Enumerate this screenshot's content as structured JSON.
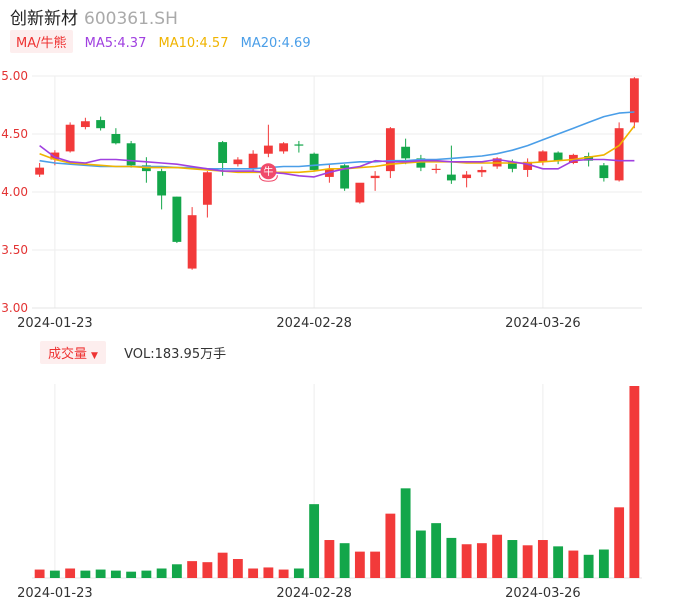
{
  "header": {
    "name": "创新新材",
    "code": "600361.SH"
  },
  "ma_legend": {
    "selector": "MA/牛熊",
    "items": [
      {
        "label": "MA5:4.37",
        "color": "#a040e0"
      },
      {
        "label": "MA10:4.57",
        "color": "#f0b400"
      },
      {
        "label": "MA20:4.69",
        "color": "#4a9ee8"
      }
    ]
  },
  "volume_legend": {
    "selector": "成交量",
    "value": "VOL:183.95万手"
  },
  "bull_marker": "牛",
  "colors": {
    "up": "#f23a3a",
    "down": "#13a64a",
    "price_axis": "#e33333",
    "grid": "#eeeeee"
  },
  "chart_data": [
    {
      "type": "candlestick",
      "y_ticks": [
        "5.00",
        "4.50",
        "4.00",
        "3.50",
        "3.00"
      ],
      "ylim": [
        3.0,
        5.0
      ],
      "x_ticks": [
        {
          "label": "2024-01-23",
          "index": 1
        },
        {
          "label": "2024-02-28",
          "index": 18
        },
        {
          "label": "2024-03-26",
          "index": 33
        }
      ],
      "candles": [
        {
          "o": 4.15,
          "h": 4.25,
          "l": 4.13,
          "c": 4.21
        },
        {
          "o": 4.28,
          "h": 4.36,
          "l": 4.23,
          "c": 4.34
        },
        {
          "o": 4.35,
          "h": 4.6,
          "l": 4.34,
          "c": 4.58
        },
        {
          "o": 4.56,
          "h": 4.64,
          "l": 4.54,
          "c": 4.61
        },
        {
          "o": 4.62,
          "h": 4.65,
          "l": 4.53,
          "c": 4.55
        },
        {
          "o": 4.5,
          "h": 4.55,
          "l": 4.41,
          "c": 4.42
        },
        {
          "o": 4.42,
          "h": 4.44,
          "l": 4.21,
          "c": 4.23
        },
        {
          "o": 4.23,
          "h": 4.3,
          "l": 4.08,
          "c": 4.18
        },
        {
          "o": 4.18,
          "h": 4.2,
          "l": 3.85,
          "c": 3.97
        },
        {
          "o": 3.96,
          "h": 3.96,
          "l": 3.56,
          "c": 3.57
        },
        {
          "o": 3.34,
          "h": 3.87,
          "l": 3.33,
          "c": 3.8
        },
        {
          "o": 3.89,
          "h": 4.18,
          "l": 3.78,
          "c": 4.17
        },
        {
          "o": 4.43,
          "h": 4.44,
          "l": 4.14,
          "c": 4.25
        },
        {
          "o": 4.24,
          "h": 4.3,
          "l": 4.22,
          "c": 4.28
        },
        {
          "o": 4.2,
          "h": 4.36,
          "l": 4.18,
          "c": 4.33
        },
        {
          "o": 4.33,
          "h": 4.58,
          "l": 4.3,
          "c": 4.4
        },
        {
          "o": 4.35,
          "h": 4.43,
          "l": 4.33,
          "c": 4.42
        },
        {
          "o": 4.41,
          "h": 4.44,
          "l": 4.34,
          "c": 4.4
        },
        {
          "o": 4.33,
          "h": 4.34,
          "l": 4.18,
          "c": 4.19
        },
        {
          "o": 4.13,
          "h": 4.24,
          "l": 4.08,
          "c": 4.2
        },
        {
          "o": 4.23,
          "h": 4.24,
          "l": 4.01,
          "c": 4.03
        },
        {
          "o": 3.91,
          "h": 4.07,
          "l": 3.9,
          "c": 4.08
        },
        {
          "o": 4.12,
          "h": 4.18,
          "l": 4.01,
          "c": 4.14
        },
        {
          "o": 4.18,
          "h": 4.56,
          "l": 4.12,
          "c": 4.55
        },
        {
          "o": 4.39,
          "h": 4.46,
          "l": 4.24,
          "c": 4.29
        },
        {
          "o": 4.29,
          "h": 4.32,
          "l": 4.18,
          "c": 4.21
        },
        {
          "o": 4.19,
          "h": 4.24,
          "l": 4.16,
          "c": 4.2
        },
        {
          "o": 4.15,
          "h": 4.4,
          "l": 4.07,
          "c": 4.1
        },
        {
          "o": 4.12,
          "h": 4.18,
          "l": 4.04,
          "c": 4.15
        },
        {
          "o": 4.17,
          "h": 4.22,
          "l": 4.13,
          "c": 4.19
        },
        {
          "o": 4.22,
          "h": 4.3,
          "l": 4.2,
          "c": 4.29
        },
        {
          "o": 4.26,
          "h": 4.28,
          "l": 4.17,
          "c": 4.2
        },
        {
          "o": 4.19,
          "h": 4.29,
          "l": 4.13,
          "c": 4.26
        },
        {
          "o": 4.26,
          "h": 4.36,
          "l": 4.23,
          "c": 4.35
        },
        {
          "o": 4.34,
          "h": 4.35,
          "l": 4.24,
          "c": 4.27
        },
        {
          "o": 4.25,
          "h": 4.33,
          "l": 4.24,
          "c": 4.32
        },
        {
          "o": 4.31,
          "h": 4.34,
          "l": 4.22,
          "c": 4.27
        },
        {
          "o": 4.23,
          "h": 4.25,
          "l": 4.09,
          "c": 4.12
        },
        {
          "o": 4.1,
          "h": 4.6,
          "l": 4.09,
          "c": 4.55
        },
        {
          "o": 4.6,
          "h": 4.99,
          "l": 4.55,
          "c": 4.98
        }
      ],
      "ma5": [
        4.4,
        4.3,
        4.26,
        4.25,
        4.28,
        4.28,
        4.27,
        4.26,
        4.25,
        4.24,
        4.22,
        4.2,
        4.18,
        4.18,
        4.18,
        4.17,
        4.16,
        4.14,
        4.13,
        4.17,
        4.2,
        4.22,
        4.27,
        4.26,
        4.26,
        4.27,
        4.27,
        4.26,
        4.26,
        4.26,
        4.28,
        4.26,
        4.24,
        4.2,
        4.2,
        4.27,
        4.28,
        4.28,
        4.27,
        4.27
      ],
      "ma10": [
        4.33,
        4.28,
        4.25,
        4.24,
        4.23,
        4.22,
        4.22,
        4.21,
        4.21,
        4.21,
        4.2,
        4.19,
        4.18,
        4.17,
        4.17,
        4.17,
        4.17,
        4.17,
        4.18,
        4.2,
        4.2,
        4.21,
        4.22,
        4.24,
        4.25,
        4.26,
        4.26,
        4.26,
        4.25,
        4.25,
        4.25,
        4.25,
        4.25,
        4.26,
        4.27,
        4.28,
        4.3,
        4.32,
        4.4,
        4.57
      ],
      "ma20": [
        4.27,
        4.25,
        4.24,
        4.23,
        4.22,
        4.22,
        4.22,
        4.22,
        4.22,
        4.21,
        4.21,
        4.2,
        4.2,
        4.2,
        4.2,
        4.21,
        4.22,
        4.22,
        4.23,
        4.24,
        4.25,
        4.26,
        4.26,
        4.27,
        4.27,
        4.28,
        4.28,
        4.29,
        4.3,
        4.31,
        4.33,
        4.36,
        4.4,
        4.45,
        4.5,
        4.55,
        4.6,
        4.65,
        4.68,
        4.69
      ],
      "bull_marker_index": 15
    },
    {
      "type": "bar",
      "title": "成交量",
      "values": [
        8,
        7,
        9,
        7,
        8,
        7,
        6,
        7,
        9,
        13,
        16,
        15,
        24,
        18,
        9,
        10,
        8,
        9,
        70,
        36,
        33,
        25,
        25,
        61,
        85,
        45,
        52,
        38,
        32,
        33,
        41,
        36,
        31,
        36,
        30,
        26,
        22,
        27,
        67,
        182
      ],
      "up": [
        1,
        0,
        1,
        0,
        0,
        0,
        0,
        0,
        0,
        0,
        1,
        1,
        1,
        1,
        1,
        1,
        1,
        0,
        0,
        1,
        0,
        1,
        1,
        1,
        0,
        0,
        0,
        0,
        1,
        1,
        1,
        0,
        1,
        1,
        0,
        1,
        0,
        0,
        1,
        1
      ]
    }
  ]
}
